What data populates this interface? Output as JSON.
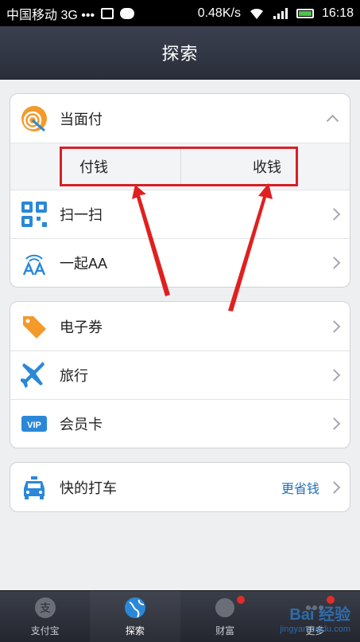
{
  "status_bar": {
    "carrier": "中国移动 3G •••",
    "speed": "0.48K/s",
    "time": "16:18",
    "icons": [
      "image-icon",
      "wechat-icon",
      "wifi-icon",
      "signal-icon",
      "battery-icon"
    ]
  },
  "header": {
    "title": "探索"
  },
  "face_pay": {
    "label": "当面付",
    "pay_label": "付钱",
    "receive_label": "收钱"
  },
  "section1": [
    {
      "label": "扫一扫",
      "icon": "qr-scan-icon"
    },
    {
      "label": "一起AA",
      "icon": "aa-icon"
    }
  ],
  "section2": [
    {
      "label": "电子券",
      "icon": "coupon-tag-icon"
    },
    {
      "label": "旅行",
      "icon": "airplane-icon"
    },
    {
      "label": "会员卡",
      "icon": "vip-card-icon"
    }
  ],
  "taxi": {
    "label": "快的打车",
    "value": "更省钱"
  },
  "tabs": [
    {
      "label": "支付宝",
      "icon": "alipay-icon"
    },
    {
      "label": "探索",
      "icon": "globe-icon"
    },
    {
      "label": "财富",
      "icon": "wealth-icon"
    },
    {
      "label": "更多",
      "icon": "more-icon"
    }
  ],
  "watermark": {
    "text": "Bai 经验",
    "sub": "jingyan.baidu.com"
  },
  "colors": {
    "accent": "#1f6fb8",
    "highlight": "#d62026",
    "nav": "#2f333f"
  }
}
